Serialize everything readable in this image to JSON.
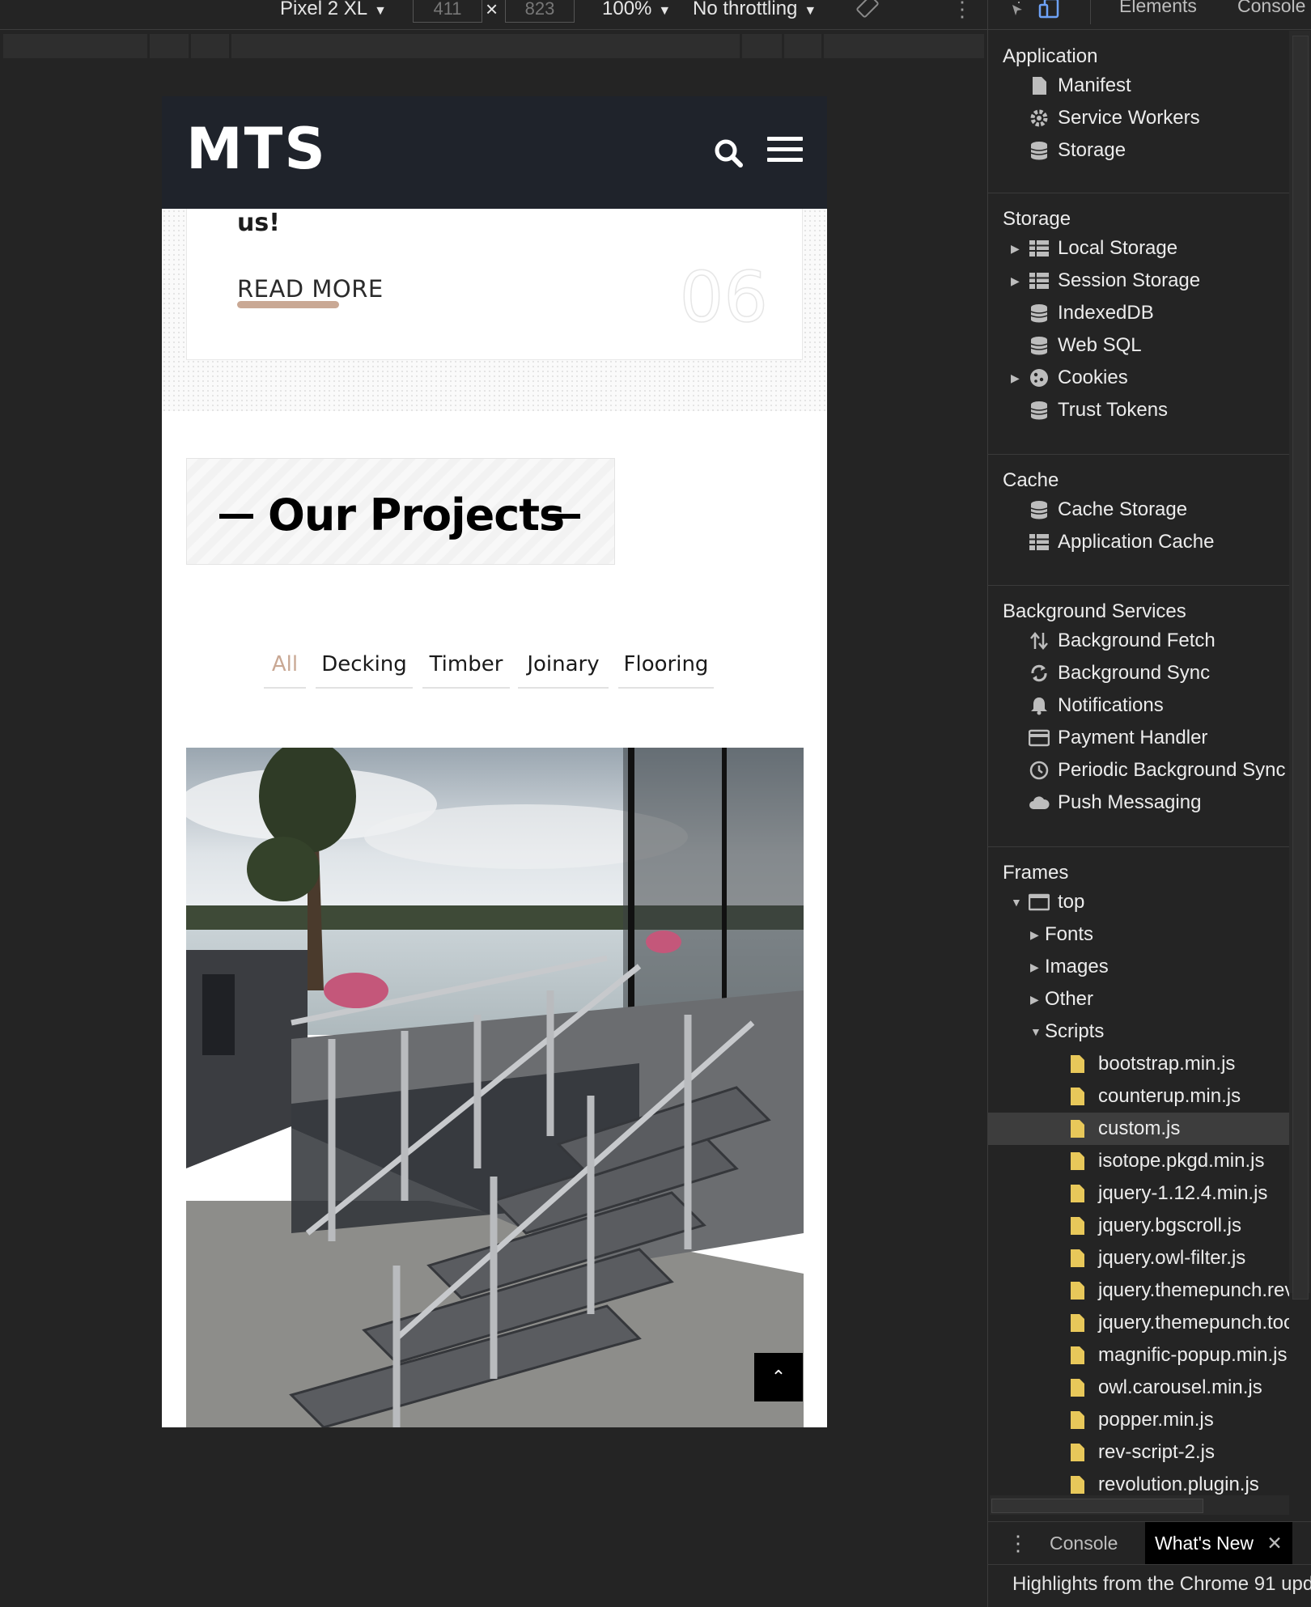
{
  "device_toolbar": {
    "device": "Pixel 2 XL",
    "width": "411",
    "times": "×",
    "height": "823",
    "zoom": "100%",
    "throttling": "No throttling"
  },
  "site": {
    "logo": "MTS",
    "card_tail_text": "us!",
    "read_more": "READ MORE",
    "card_number": "06",
    "section_title": "Our Projects",
    "filters": [
      "All",
      "Decking",
      "Timber",
      "Joinary",
      "Flooring"
    ],
    "active_filter": "All",
    "accent_color": "#c9a894",
    "header_color": "#1f232b",
    "scroll_top_icon": "chevron-up-icon"
  },
  "devtools": {
    "tabs": [
      "Elements",
      "Console"
    ],
    "sections": {
      "application": {
        "title": "Application",
        "items": [
          "Manifest",
          "Service Workers",
          "Storage"
        ]
      },
      "storage": {
        "title": "Storage",
        "items": [
          "Local Storage",
          "Session Storage",
          "IndexedDB",
          "Web SQL",
          "Cookies",
          "Trust Tokens"
        ]
      },
      "cache": {
        "title": "Cache",
        "items": [
          "Cache Storage",
          "Application Cache"
        ]
      },
      "background": {
        "title": "Background Services",
        "items": [
          "Background Fetch",
          "Background Sync",
          "Notifications",
          "Payment Handler",
          "Periodic Background Sync",
          "Push Messaging"
        ]
      },
      "frames": {
        "title": "Frames",
        "top": "top",
        "groups": [
          "Fonts",
          "Images",
          "Other",
          "Scripts"
        ],
        "scripts": [
          "bootstrap.min.js",
          "counterup.min.js",
          "custom.js",
          "isotope.pkgd.min.js",
          "jquery-1.12.4.min.js",
          "jquery.bgscroll.js",
          "jquery.owl-filter.js",
          "jquery.themepunch.rev",
          "jquery.themepunch.too",
          "magnific-popup.min.js",
          "owl.carousel.min.js",
          "popper.min.js",
          "rev-script-2.js",
          "revolution.plugin.js"
        ],
        "selected_script": "custom.js"
      }
    },
    "drawer": {
      "tabs": [
        "Console",
        "What's New"
      ],
      "active": "What's New",
      "body": "Highlights from the Chrome 91 upd"
    },
    "file_icon_color": "#e8c85a"
  }
}
